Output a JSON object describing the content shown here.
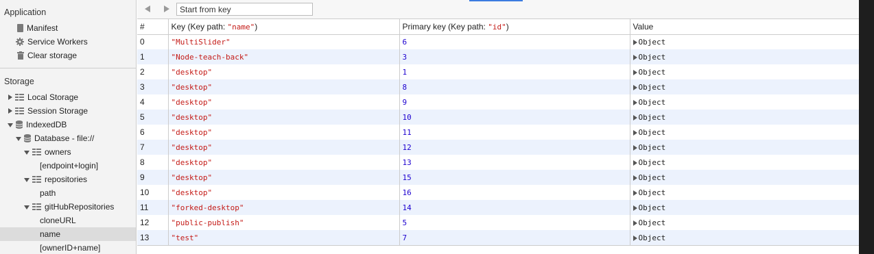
{
  "sidebar": {
    "application_title": "Application",
    "application_items": [
      {
        "label": "Manifest",
        "icon": "document-icon"
      },
      {
        "label": "Service Workers",
        "icon": "gear-icon"
      },
      {
        "label": "Clear storage",
        "icon": "trash-icon"
      }
    ],
    "storage_title": "Storage",
    "storage_items": [
      {
        "label": "Local Storage",
        "icon": "grid-icon",
        "expanded": false
      },
      {
        "label": "Session Storage",
        "icon": "grid-icon",
        "expanded": false
      },
      {
        "label": "IndexedDB",
        "icon": "database-icon",
        "expanded": true
      },
      {
        "label": "Database - file://",
        "icon": "database-icon",
        "expanded": true
      },
      {
        "label": "owners",
        "icon": "grid-icon",
        "expanded": true
      },
      {
        "label": "[endpoint+login]"
      },
      {
        "label": "repositories",
        "icon": "grid-icon",
        "expanded": true
      },
      {
        "label": "path"
      },
      {
        "label": "gitHubRepositories",
        "icon": "grid-icon",
        "expanded": true
      },
      {
        "label": "cloneURL"
      },
      {
        "label": "name",
        "selected": true
      },
      {
        "label": "[ownerID+name]"
      }
    ]
  },
  "toolbar": {
    "start_placeholder": "Start from key"
  },
  "table": {
    "headers": {
      "index": "#",
      "key_prefix": "Key (Key path: ",
      "key_path": "\"name\"",
      "key_suffix": ")",
      "primary_prefix": "Primary key (Key path: ",
      "primary_path": "\"id\"",
      "primary_suffix": ")",
      "value": "Value"
    },
    "rows": [
      {
        "index": "0",
        "key": "\"MultiSlider\"",
        "primary": "6",
        "value": "Object"
      },
      {
        "index": "1",
        "key": "\"Node-teach-back\"",
        "primary": "3",
        "value": "Object"
      },
      {
        "index": "2",
        "key": "\"desktop\"",
        "primary": "1",
        "value": "Object"
      },
      {
        "index": "3",
        "key": "\"desktop\"",
        "primary": "8",
        "value": "Object"
      },
      {
        "index": "4",
        "key": "\"desktop\"",
        "primary": "9",
        "value": "Object"
      },
      {
        "index": "5",
        "key": "\"desktop\"",
        "primary": "10",
        "value": "Object"
      },
      {
        "index": "6",
        "key": "\"desktop\"",
        "primary": "11",
        "value": "Object"
      },
      {
        "index": "7",
        "key": "\"desktop\"",
        "primary": "12",
        "value": "Object"
      },
      {
        "index": "8",
        "key": "\"desktop\"",
        "primary": "13",
        "value": "Object"
      },
      {
        "index": "9",
        "key": "\"desktop\"",
        "primary": "15",
        "value": "Object"
      },
      {
        "index": "10",
        "key": "\"desktop\"",
        "primary": "16",
        "value": "Object"
      },
      {
        "index": "11",
        "key": "\"forked-desktop\"",
        "primary": "14",
        "value": "Object"
      },
      {
        "index": "12",
        "key": "\"public-publish\"",
        "primary": "5",
        "value": "Object"
      },
      {
        "index": "13",
        "key": "\"test\"",
        "primary": "7",
        "value": "Object"
      }
    ]
  },
  "colors": {
    "string": "#c41a16",
    "number": "#1c00cf",
    "row_alt": "#ecf2fd",
    "selected": "#dcdcdc"
  }
}
